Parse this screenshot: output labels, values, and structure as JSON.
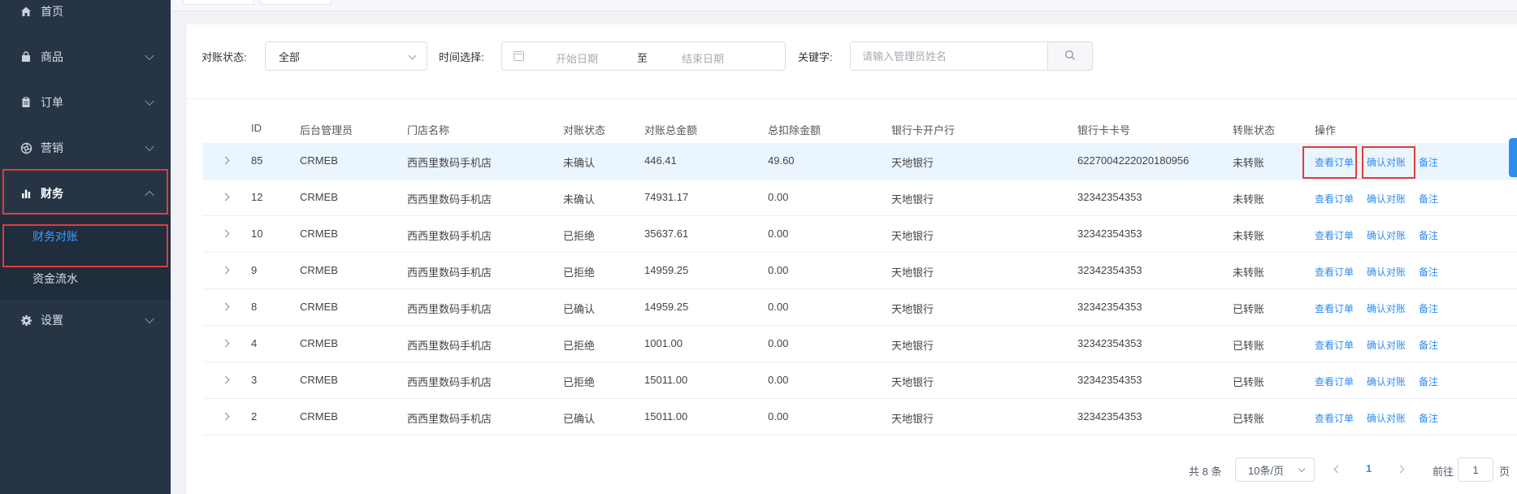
{
  "sidebar": {
    "items": [
      {
        "label": "首页",
        "icon": "home-icon"
      },
      {
        "label": "商品",
        "icon": "bag-icon"
      },
      {
        "label": "订单",
        "icon": "clipboard-icon"
      },
      {
        "label": "营销",
        "icon": "aperture-icon"
      },
      {
        "label": "财务",
        "icon": "bar-chart-icon"
      },
      {
        "label": "设置",
        "icon": "gear-icon"
      }
    ],
    "sub_items": [
      {
        "label": "财务对账"
      },
      {
        "label": "资金流水"
      }
    ]
  },
  "filters": {
    "status_label": "对账状态:",
    "status_value": "全部",
    "date_label": "时间选择:",
    "date_start_placeholder": "开始日期",
    "date_separator": "至",
    "date_end_placeholder": "结束日期",
    "keyword_label": "关键字:",
    "keyword_placeholder": "请输入管理员姓名"
  },
  "table": {
    "headers": [
      "ID",
      "后台管理员",
      "门店名称",
      "对账状态",
      "对账总金额",
      "总扣除金额",
      "银行卡开户行",
      "银行卡卡号",
      "转账状态",
      "操作"
    ],
    "rows": [
      {
        "id": "85",
        "admin": "CRMEB",
        "store": "西西里数码手机店",
        "status": "未确认",
        "total": "446.41",
        "deduct": "49.60",
        "bank": "天地银行",
        "card": "6227004222020180956",
        "transfer": "未转账"
      },
      {
        "id": "12",
        "admin": "CRMEB",
        "store": "西西里数码手机店",
        "status": "未确认",
        "total": "74931.17",
        "deduct": "0.00",
        "bank": "天地银行",
        "card": "32342354353",
        "transfer": "未转账"
      },
      {
        "id": "10",
        "admin": "CRMEB",
        "store": "西西里数码手机店",
        "status": "已拒绝",
        "total": "35637.61",
        "deduct": "0.00",
        "bank": "天地银行",
        "card": "32342354353",
        "transfer": "未转账"
      },
      {
        "id": "9",
        "admin": "CRMEB",
        "store": "西西里数码手机店",
        "status": "已拒绝",
        "total": "14959.25",
        "deduct": "0.00",
        "bank": "天地银行",
        "card": "32342354353",
        "transfer": "未转账"
      },
      {
        "id": "8",
        "admin": "CRMEB",
        "store": "西西里数码手机店",
        "status": "已确认",
        "total": "14959.25",
        "deduct": "0.00",
        "bank": "天地银行",
        "card": "32342354353",
        "transfer": "已转账"
      },
      {
        "id": "4",
        "admin": "CRMEB",
        "store": "西西里数码手机店",
        "status": "已拒绝",
        "total": "1001.00",
        "deduct": "0.00",
        "bank": "天地银行",
        "card": "32342354353",
        "transfer": "已转账"
      },
      {
        "id": "3",
        "admin": "CRMEB",
        "store": "西西里数码手机店",
        "status": "已拒绝",
        "total": "15011.00",
        "deduct": "0.00",
        "bank": "天地银行",
        "card": "32342354353",
        "transfer": "已转账"
      },
      {
        "id": "2",
        "admin": "CRMEB",
        "store": "西西里数码手机店",
        "status": "已确认",
        "total": "15011.00",
        "deduct": "0.00",
        "bank": "天地银行",
        "card": "32342354353",
        "transfer": "已转账"
      }
    ],
    "actions": {
      "view_orders": "查看订单",
      "confirm": "确认对账",
      "remark": "备注"
    }
  },
  "pagination": {
    "total_text": "共 8 条",
    "page_size": "10条/页",
    "current_page": "1",
    "goto_label": "前往",
    "goto_value": "1",
    "page_label": "页"
  },
  "colors": {
    "sidebar_bg": "#263445",
    "accent": "#2d8cf0",
    "highlight_box": "#e33b3b",
    "selected_row_bg": "#ebf5fe"
  }
}
